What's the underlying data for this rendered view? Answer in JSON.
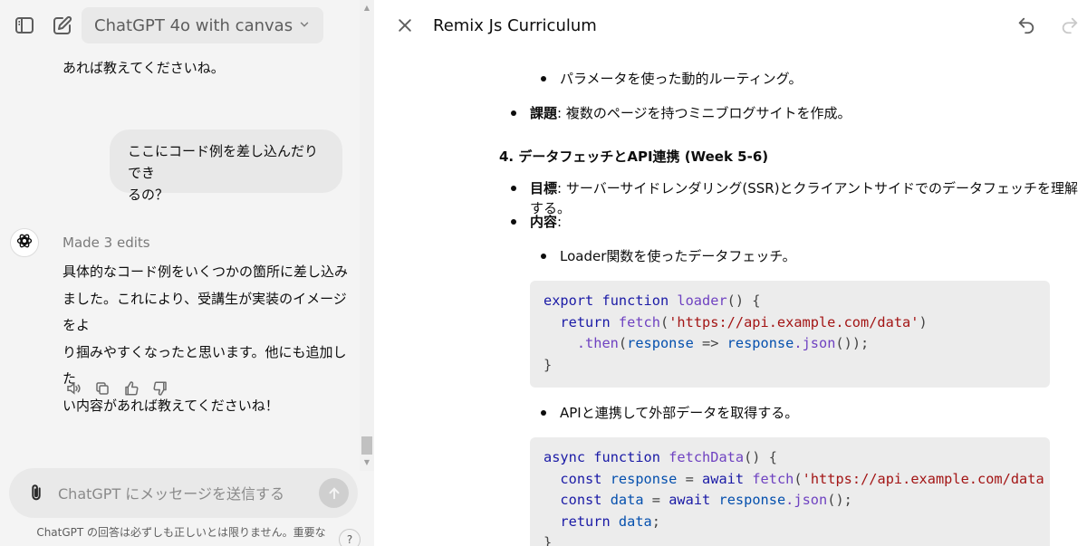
{
  "header": {
    "model_name": "ChatGPT 4o with canvas"
  },
  "chat": {
    "prev_assistant_tail": "あれば教えてくださいね。",
    "user_message_line1": "ここにコード例を差し込んだりでき",
    "user_message_line2": "るの？",
    "assistant_status": "Made 3 edits",
    "assistant_reply_lines": [
      "具体的なコード例をいくつかの箇所に差し込み",
      "ました。これにより、受講生が実装のイメージをよ",
      "り掴みやすくなったと思います。他にも追加した",
      "い内容があれば教えてくださいね！"
    ]
  },
  "composer": {
    "placeholder": "ChatGPT にメッセージを送信する",
    "disclaimer_line1": "ChatGPT の回答は必ずしも正しいとは限りません。重要な",
    "help_label": "?"
  },
  "canvas": {
    "title": "Remix Js Curriculum",
    "item_dynamic_routing": "パラメータを使った動的ルーティング。",
    "task_label": "課題",
    "task_text": ": 複数のページを持つミニブログサイトを作成。",
    "section4_heading": "4. データフェッチとAPI連携 (Week 5-6)",
    "goal_label": "目標",
    "goal_text": ": サーバーサイドレンダリング(SSR)とクライアントサイドでのデータフェッチを理解する。",
    "content_label": "内容",
    "content_colon": ":",
    "item_loader": "Loader関数を使ったデータフェッチ。",
    "item_api": "APIと連携して外部データを取得する。",
    "code1": {
      "l1_kw1": "export",
      "l1_kw2": "function",
      "l1_fn": "loader",
      "l1_rest": "() {",
      "l2_kw": "return",
      "l2_fn": "fetch",
      "l2_str": "'https://api.example.com/data'",
      "l2_end": ")",
      "l3_fn": ".then",
      "l3_var1": "response",
      "l3_arrow": "=>",
      "l3_var2": "response",
      "l3_fn2": ".json",
      "l3_end": "());",
      "l4": "}"
    },
    "code2": {
      "l1_kw1": "async",
      "l1_kw2": "function",
      "l1_fn": "fetchData",
      "l1_rest": "() {",
      "l2_kw": "const",
      "l2_var": "response",
      "l2_eq": "=",
      "l2_kw2": "await",
      "l2_fn": "fetch",
      "l2_str": "'https://api.example.com/data",
      "l3_kw": "const",
      "l3_var": "data",
      "l3_eq": "=",
      "l3_kw2": "await",
      "l3_var2": "response",
      "l3_fn": ".json",
      "l3_end": "();",
      "l4_kw": "return",
      "l4_var": "data",
      "l4_end": ";",
      "l5": "}"
    }
  }
}
